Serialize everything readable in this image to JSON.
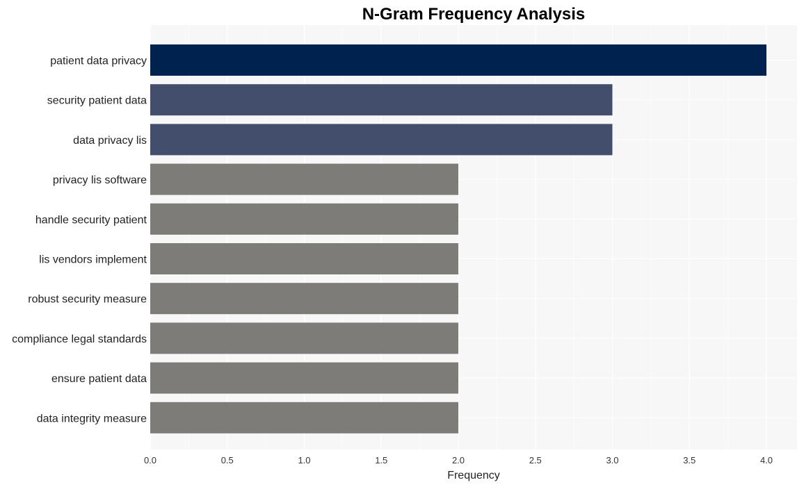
{
  "chart_data": {
    "type": "bar",
    "orientation": "horizontal",
    "title": "N-Gram Frequency Analysis",
    "xlabel": "Frequency",
    "ylabel": "",
    "xlim": [
      0,
      4.2
    ],
    "xticks": [
      0.0,
      0.5,
      1.0,
      1.5,
      2.0,
      2.5,
      3.0,
      3.5,
      4.0
    ],
    "xtick_labels": [
      "0.0",
      "0.5",
      "1.0",
      "1.5",
      "2.0",
      "2.5",
      "3.0",
      "3.5",
      "4.0"
    ],
    "grid": true,
    "categories": [
      "patient data privacy",
      "security patient data",
      "data privacy lis",
      "privacy lis software",
      "handle security patient",
      "lis vendors implement",
      "robust security measure",
      "compliance legal standards",
      "ensure patient data",
      "data integrity measure"
    ],
    "values": [
      4,
      3,
      3,
      2,
      2,
      2,
      2,
      2,
      2,
      2
    ],
    "colors": {
      "4": "#00224e",
      "3": "#434e6c",
      "2": "#7d7c78"
    },
    "plot_background": "#f7f7f7",
    "grid_color": "#ffffff"
  }
}
